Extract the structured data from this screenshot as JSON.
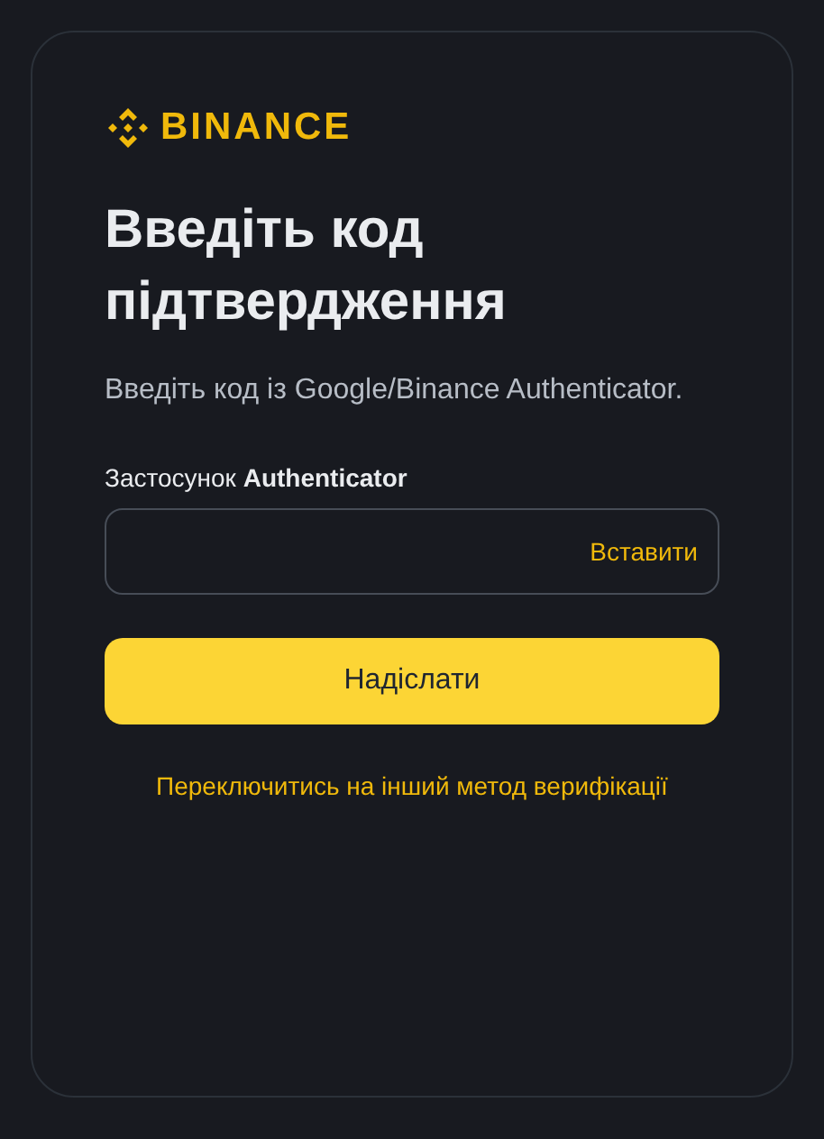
{
  "logo": {
    "text": "BINANCE"
  },
  "title": "Введіть код підтвердження",
  "subtitle": "Введіть код із Google/Binance Authenticator.",
  "field": {
    "label": "Застосунок **Authenticator**",
    "paste": "Вставити"
  },
  "submit": "Надіслати",
  "switch_link": "Переключитись на інший метод верифікації"
}
